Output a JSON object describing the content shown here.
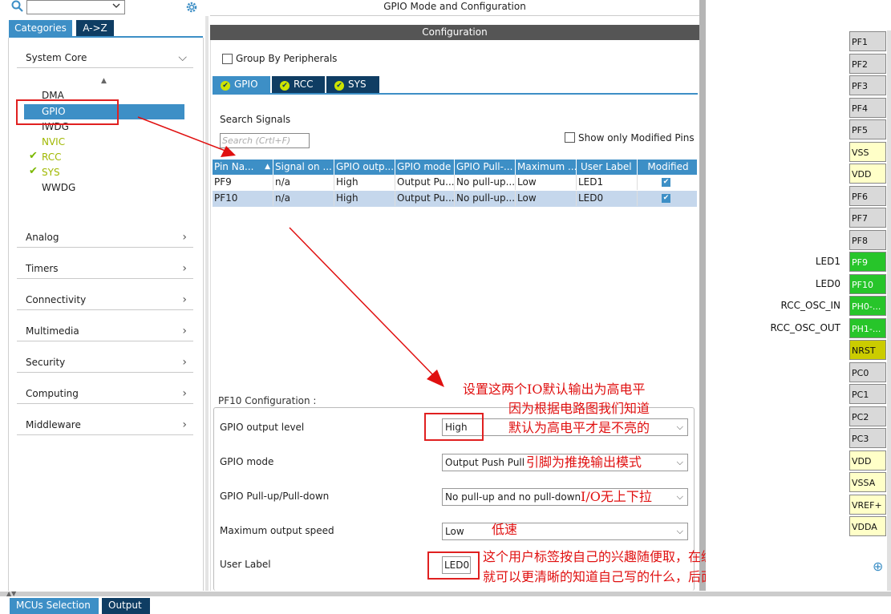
{
  "left_panel": {
    "search_placeholder": "",
    "tabs": [
      "Categories",
      "A->Z"
    ],
    "system_core": {
      "label": "System Core",
      "items": [
        "DMA",
        "GPIO",
        "IWDG",
        "NVIC",
        "RCC",
        "SYS",
        "WWDG"
      ]
    },
    "categories": [
      "Analog",
      "Timers",
      "Connectivity",
      "Multimedia",
      "Security",
      "Computing",
      "Middleware"
    ]
  },
  "main": {
    "window_title": "GPIO Mode and Configuration",
    "config_header": "Configuration",
    "group_by_peripherals": "Group By Peripherals",
    "peripheral_tabs": [
      "GPIO",
      "RCC",
      "SYS"
    ],
    "search_signals_label": "Search Signals",
    "search_placeholder": "Search (Crtl+F)",
    "show_modified_label": "Show only Modified Pins",
    "table": {
      "columns": [
        "Pin Na...",
        "Signal on ...",
        "GPIO outp...",
        "GPIO mode",
        "GPIO Pull-...",
        "Maximum ...",
        "User Label",
        "Modified"
      ],
      "rows": [
        {
          "pin": "PF9",
          "signal": "n/a",
          "output": "High",
          "mode": "Output Pu...",
          "pull": "No pull-up...",
          "speed": "Low",
          "label": "LED1",
          "modified": true
        },
        {
          "pin": "PF10",
          "signal": "n/a",
          "output": "High",
          "mode": "Output Pu...",
          "pull": "No pull-up...",
          "speed": "Low",
          "label": "LED0",
          "modified": true
        }
      ]
    },
    "pf10_config": {
      "title": "PF10 Configuration :",
      "fields": [
        {
          "label": "GPIO output level",
          "value": "High"
        },
        {
          "label": "GPIO mode",
          "value": "Output Push Pull"
        },
        {
          "label": "GPIO Pull-up/Pull-down",
          "value": "No pull-up and no pull-down"
        },
        {
          "label": "Maximum output speed",
          "value": "Low"
        },
        {
          "label": "User Label",
          "value": "LED0"
        }
      ]
    }
  },
  "annotations": {
    "a1": "设置这两个IO默认输出为高电平",
    "a2": "因为根据电路图我们知道",
    "a3": "默认为高电平才是不亮的",
    "a4": "引脚为推挽输出模式",
    "a5": "I/O无上下拉",
    "a6": "低速",
    "a7": "这个用户标签按自己的兴趣随便取，在编程的时候",
    "a8": "就可以更清晰的知道自己写的什么，后面写代码我会演示"
  },
  "pinout": {
    "pins": [
      {
        "name": "PF1",
        "color": "gray"
      },
      {
        "name": "PF2",
        "color": "gray"
      },
      {
        "name": "PF3",
        "color": "gray"
      },
      {
        "name": "PF4",
        "color": "gray"
      },
      {
        "name": "PF5",
        "color": "gray"
      },
      {
        "name": "VSS",
        "color": "yellow"
      },
      {
        "name": "VDD",
        "color": "yellow"
      },
      {
        "name": "PF6",
        "color": "gray"
      },
      {
        "name": "PF7",
        "color": "gray"
      },
      {
        "name": "PF8",
        "color": "gray"
      },
      {
        "name": "PF9",
        "color": "green",
        "label": "LED1"
      },
      {
        "name": "PF10",
        "color": "green",
        "label": "LED0"
      },
      {
        "name": "PH0-...",
        "color": "green",
        "label": "RCC_OSC_IN"
      },
      {
        "name": "PH1-...",
        "color": "green",
        "label": "RCC_OSC_OUT"
      },
      {
        "name": "NRST",
        "color": "olive"
      },
      {
        "name": "PC0",
        "color": "gray"
      },
      {
        "name": "PC1",
        "color": "gray"
      },
      {
        "name": "PC2",
        "color": "gray"
      },
      {
        "name": "PC3",
        "color": "gray"
      },
      {
        "name": "VDD",
        "color": "yellow"
      },
      {
        "name": "VSSA",
        "color": "yellow"
      },
      {
        "name": "VREF+",
        "color": "yellow"
      },
      {
        "name": "VDDA",
        "color": "yellow"
      }
    ]
  },
  "bottom_tabs": [
    "MCUs Selection",
    "Output"
  ],
  "colors": {
    "accent": "#3d8fc6",
    "dark_tab": "#0f3d63",
    "pin_green": "#27c52a",
    "annotation_red": "#e01010"
  }
}
